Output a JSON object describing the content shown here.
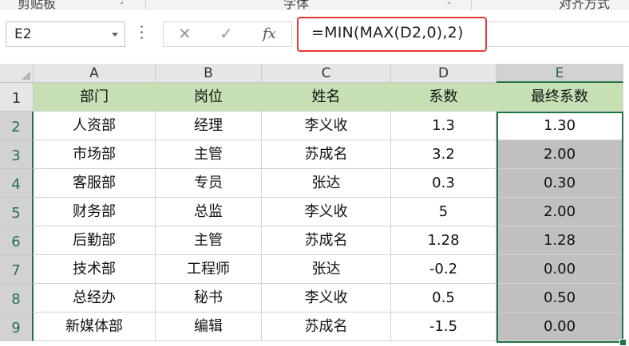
{
  "ribbon": {
    "groups": [
      "剪贴板",
      "字体",
      "对齐方式"
    ]
  },
  "formula_bar": {
    "name_box": "E2",
    "cancel_glyph": "✕",
    "enter_glyph": "✓",
    "fx_label": "fx",
    "formula": "=MIN(MAX(D2,0),2)"
  },
  "grid": {
    "columns": [
      "A",
      "B",
      "C",
      "D",
      "E"
    ],
    "rows": [
      "1",
      "2",
      "3",
      "4",
      "5",
      "6",
      "7",
      "8",
      "9"
    ],
    "selected_cell": "E2",
    "header_fill": "#c6e0b4",
    "shaded_fill": "#c0c0c0",
    "selection_color": "#217346",
    "highlight_color": "#e53935",
    "table": {
      "headers": [
        "部门",
        "岗位",
        "姓名",
        "系数",
        "最终系数"
      ],
      "rows": [
        [
          "人资部",
          "经理",
          "李义收",
          "1.3",
          "1.30"
        ],
        [
          "市场部",
          "主管",
          "苏成名",
          "3.2",
          "2.00"
        ],
        [
          "客服部",
          "专员",
          "张达",
          "0.3",
          "0.30"
        ],
        [
          "财务部",
          "总监",
          "李义收",
          "5",
          "2.00"
        ],
        [
          "后勤部",
          "主管",
          "苏成名",
          "1.28",
          "1.28"
        ],
        [
          "技术部",
          "工程师",
          "张达",
          "-0.2",
          "0.00"
        ],
        [
          "总经办",
          "秘书",
          "李义收",
          "0.5",
          "0.50"
        ],
        [
          "新媒体部",
          "编辑",
          "苏成名",
          "-1.5",
          "0.00"
        ]
      ]
    }
  }
}
